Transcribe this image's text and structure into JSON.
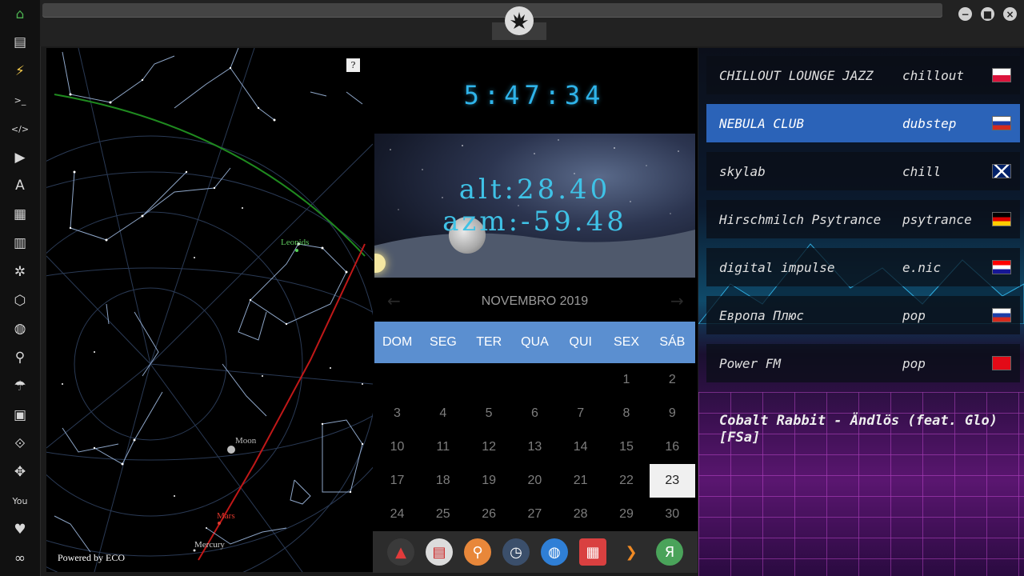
{
  "sidebar": {
    "items": [
      {
        "icon": "home-icon",
        "glyph": "⌂",
        "color": "#4caf50"
      },
      {
        "icon": "document-icon",
        "glyph": "▤"
      },
      {
        "icon": "lightning-icon",
        "glyph": "⚡",
        "color": "#f2c94c"
      },
      {
        "icon": "terminal-icon",
        "glyph": ">_"
      },
      {
        "icon": "code-icon",
        "glyph": "</>"
      },
      {
        "icon": "play-icon",
        "glyph": "▶"
      },
      {
        "icon": "translate-icon",
        "glyph": "A"
      },
      {
        "icon": "image-icon",
        "glyph": "▦"
      },
      {
        "icon": "newspaper-icon",
        "glyph": "▥"
      },
      {
        "icon": "empire-icon",
        "glyph": "✲"
      },
      {
        "icon": "hexagon-icon",
        "glyph": "⬡"
      },
      {
        "icon": "globe-icon",
        "glyph": "◍"
      },
      {
        "icon": "search-icon",
        "glyph": "⚲"
      },
      {
        "icon": "umbrella-icon",
        "glyph": "☂"
      },
      {
        "icon": "contacts-icon",
        "glyph": "▣"
      },
      {
        "icon": "code-fork-icon",
        "glyph": "⟐"
      },
      {
        "icon": "expand-icon",
        "glyph": "✥"
      },
      {
        "icon": "youtube-icon",
        "glyph": "You"
      },
      {
        "icon": "heart-icon",
        "glyph": "♥"
      },
      {
        "icon": "infinity-icon",
        "glyph": "∞"
      }
    ]
  },
  "window": {
    "minimize_glyph": "−",
    "maximize_glyph": "■",
    "close_glyph": "×",
    "logo_icon": "rebel-alliance-icon"
  },
  "starmap": {
    "help_label": "?",
    "powered_by": "Powered by ECO",
    "labels": {
      "leonids": "Leonids",
      "moon": "Moon",
      "mars": "Mars",
      "mercury": "Mercury"
    },
    "colors": {
      "ecliptic": "#c01818",
      "horizon": "#1f8a1f",
      "lines": "#8ea6c8"
    }
  },
  "clock": {
    "time": "5:47:34"
  },
  "moon": {
    "alt": "alt:28.40",
    "azm": "azm:-59.48"
  },
  "calendar": {
    "month_label": "NOVEMBRO 2019",
    "prev_glyph": "←",
    "next_glyph": "→",
    "days_of_week": [
      "DOM",
      "SEG",
      "TER",
      "QUA",
      "QUI",
      "SEX",
      "SÁB"
    ],
    "weeks": [
      [
        "",
        "",
        "",
        "",
        "",
        "1",
        "2"
      ],
      [
        "3",
        "4",
        "5",
        "6",
        "7",
        "8",
        "9"
      ],
      [
        "10",
        "11",
        "12",
        "13",
        "14",
        "15",
        "16"
      ],
      [
        "17",
        "18",
        "19",
        "20",
        "21",
        "22",
        "23"
      ],
      [
        "24",
        "25",
        "26",
        "27",
        "28",
        "29",
        "30"
      ]
    ],
    "today": "23"
  },
  "dock": {
    "apps": [
      {
        "icon": "app-red-triangle-icon",
        "glyph": "▲",
        "bg": "#3a3a3a",
        "fg": "#e23b3b"
      },
      {
        "icon": "news-app-icon",
        "glyph": "▤",
        "bg": "#dcdcdc",
        "fg": "#c22"
      },
      {
        "icon": "search-app-icon",
        "glyph": "⚲",
        "bg": "#e8873a",
        "fg": "#fff"
      },
      {
        "icon": "clock-app-icon",
        "glyph": "◷",
        "bg": "#3b4f6b",
        "fg": "#fff"
      },
      {
        "icon": "globe-app-icon",
        "glyph": "◍",
        "bg": "#2f7fd6",
        "fg": "#fff"
      },
      {
        "icon": "calendar-app-icon",
        "glyph": "▦",
        "bg": "#d94040",
        "fg": "#fff"
      },
      {
        "icon": "arrow-app-icon",
        "glyph": "❯",
        "bg": "#2c2c2c",
        "fg": "#f08a24"
      },
      {
        "icon": "yandex-app-icon",
        "glyph": "Я",
        "bg": "#4aa35a",
        "fg": "#fff"
      }
    ]
  },
  "radio": {
    "stations": [
      {
        "name": "CHILLOUT LOUNGE JAZZ",
        "genre": "chillout",
        "flag": "poland-flag-icon"
      },
      {
        "name": "NEBULA CLUB",
        "genre": "dubstep",
        "flag": "russia-flag-icon",
        "active": true
      },
      {
        "name": "skylab",
        "genre": "chill",
        "flag": "uk-flag-icon"
      },
      {
        "name": "Hirschmilch Psytrance",
        "genre": "psytrance",
        "flag": "germany-flag-icon"
      },
      {
        "name": "digital impulse",
        "genre": "e.nic",
        "flag": "croatia-flag-icon"
      },
      {
        "name": "Европа Плюс",
        "genre": "pop",
        "flag": "russia-flag-icon"
      },
      {
        "name": "Power FM",
        "genre": "pop",
        "flag": "turkey-flag-icon"
      }
    ],
    "now_playing": "Cobalt Rabbit - Ändlös (feat. Glo) [FSa]"
  }
}
